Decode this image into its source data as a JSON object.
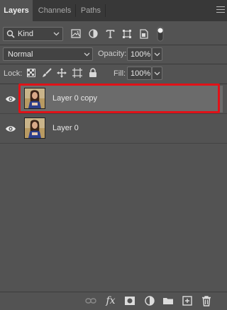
{
  "tabs": [
    {
      "label": "Layers",
      "active": true
    },
    {
      "label": "Channels",
      "active": false
    },
    {
      "label": "Paths",
      "active": false
    }
  ],
  "filter": {
    "kind_label": "Kind",
    "icons": [
      "image-filter-icon",
      "adjustment-filter-icon",
      "type-filter-icon",
      "shape-filter-icon",
      "smart-object-filter-icon",
      "filter-toggle-icon"
    ]
  },
  "blend": {
    "mode": "Normal",
    "opacity_label": "Opacity:",
    "opacity_value": "100%"
  },
  "lock": {
    "label": "Lock:",
    "icons": [
      "lock-transparent-pixels-icon",
      "lock-image-pixels-icon",
      "lock-position-icon",
      "lock-artboard-icon",
      "lock-all-icon"
    ],
    "fill_label": "Fill:",
    "fill_value": "100%"
  },
  "layers": [
    {
      "name": "Layer 0 copy",
      "visible": true,
      "selected": true
    },
    {
      "name": "Layer 0",
      "visible": true,
      "selected": false
    }
  ],
  "bottom_icons": [
    "link-layers-icon",
    "fx-icon",
    "add-mask-icon",
    "new-adjustment-layer-icon",
    "new-group-icon",
    "new-layer-icon",
    "delete-layer-icon"
  ],
  "colors": {
    "panel_bg": "#535353",
    "tab_bar_bg": "#383838",
    "selected_row": "#6b6b6b",
    "highlight_outline": "#e01218"
  }
}
